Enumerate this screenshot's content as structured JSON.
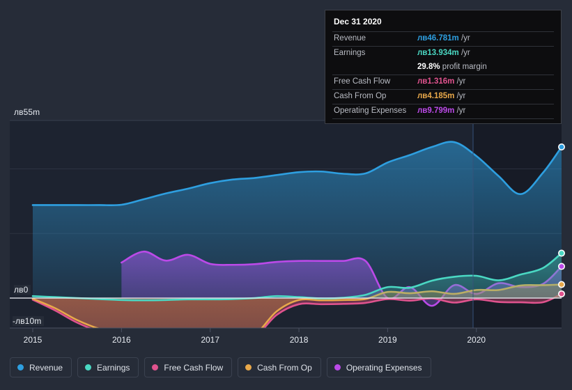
{
  "currency_symbol": "лв",
  "colors": {
    "background": "#262c38",
    "plot_background": "#1d2330",
    "plot_background_forecast": "#171b26",
    "gridline": "#3a4150",
    "zero_line": "#e8ecf2",
    "revenue": "#2e9fe0",
    "earnings": "#4ad8c3",
    "free_cash_flow": "#e0538e",
    "cash_from_op": "#e8a84a",
    "operating_expenses": "#bb4ae8"
  },
  "tooltip": {
    "title": "Dec 31 2020",
    "rows": [
      {
        "key": "Revenue",
        "symbol": "лв",
        "value": "46.781m",
        "unit": "/yr",
        "color": "#2e9fe0"
      },
      {
        "key": "Earnings",
        "symbol": "лв",
        "value": "13.934m",
        "unit": "/yr",
        "color": "#4ad8c3"
      },
      {
        "key": "Free Cash Flow",
        "symbol": "лв",
        "value": "1.316m",
        "unit": "/yr",
        "color": "#e0538e"
      },
      {
        "key": "Cash From Op",
        "symbol": "лв",
        "value": "4.185m",
        "unit": "/yr",
        "color": "#e8a84a"
      },
      {
        "key": "Operating Expenses",
        "symbol": "лв",
        "value": "9.799m",
        "unit": "/yr",
        "color": "#bb4ae8"
      }
    ],
    "profit_margin_value": "29.8%",
    "profit_margin_label": "profit margin"
  },
  "legend": {
    "items": [
      {
        "label": "Revenue",
        "color": "#2e9fe0"
      },
      {
        "label": "Earnings",
        "color": "#4ad8c3"
      },
      {
        "label": "Free Cash Flow",
        "color": "#e0538e"
      },
      {
        "label": "Cash From Op",
        "color": "#e8a84a"
      },
      {
        "label": "Operating Expenses",
        "color": "#bb4ae8"
      }
    ]
  },
  "axes": {
    "y_labels": {
      "top": "лв55m",
      "zero": "лв0",
      "bottom": "-лв10m"
    },
    "x_labels": [
      "2015",
      "2016",
      "2017",
      "2018",
      "2019",
      "2020"
    ]
  },
  "chart_data": {
    "type": "area",
    "title": "",
    "xlabel": "",
    "ylabel": "",
    "ylim": [
      -10,
      55
    ],
    "ytick_values": [
      55,
      0,
      -10
    ],
    "ytick_labels": [
      "лв55m",
      "лв0",
      "-лв10m"
    ],
    "gridlines": [
      55,
      40,
      20
    ],
    "grid": true,
    "zero_line": 0,
    "legend_position": "bottom",
    "x": [
      "2015.00",
      "2015.25",
      "2015.50",
      "2015.75",
      "2016.00",
      "2016.25",
      "2016.50",
      "2016.75",
      "2017.00",
      "2017.25",
      "2017.50",
      "2017.75",
      "2018.00",
      "2018.25",
      "2018.50",
      "2018.75",
      "2019.00",
      "2019.25",
      "2019.50",
      "2019.75",
      "2020.00",
      "2020.25",
      "2020.50",
      "2020.75",
      "2020.96"
    ],
    "forecast_divider_x": "2020.00",
    "series": [
      {
        "name": "Revenue",
        "color": "#2e9fe0",
        "values": [
          28.8,
          28.8,
          28.8,
          28.8,
          28.9,
          30.6,
          32.4,
          33.9,
          35.6,
          36.7,
          37.2,
          38.1,
          39.0,
          39.2,
          38.5,
          38.6,
          42.0,
          44.3,
          46.8,
          48.3,
          44.0,
          37.8,
          32.2,
          38.8,
          46.8
        ]
      },
      {
        "name": "Earnings",
        "color": "#4ad8c3",
        "values": [
          0.6,
          0.3,
          0.0,
          -0.3,
          -0.6,
          -0.7,
          -0.6,
          -0.4,
          -0.4,
          -0.3,
          0.0,
          0.6,
          0.3,
          -0.1,
          0.1,
          1.0,
          3.4,
          3.2,
          5.4,
          6.6,
          6.9,
          5.5,
          7.3,
          9.3,
          13.9
        ]
      },
      {
        "name": "Free Cash Flow",
        "color": "#e0538e",
        "values": [
          -0.5,
          -3.8,
          -7.6,
          -10.3,
          -11.6,
          -11.8,
          -11.6,
          -11.8,
          -11.8,
          -11.7,
          -11.9,
          -5.2,
          -1.9,
          -1.9,
          -1.8,
          -1.5,
          -0.3,
          -0.8,
          -0.1,
          -1.4,
          -0.4,
          -1.2,
          -1.3,
          -1.3,
          1.3
        ]
      },
      {
        "name": "Cash From Op",
        "color": "#e8a84a",
        "values": [
          -0.2,
          -3.1,
          -6.8,
          -9.5,
          -10.8,
          -11.1,
          -10.9,
          -11.1,
          -11.1,
          -11.0,
          -11.2,
          -4.1,
          -0.6,
          -0.7,
          -0.6,
          -0.3,
          1.9,
          1.5,
          2.1,
          1.3,
          2.5,
          2.5,
          3.9,
          4.0,
          4.2
        ]
      },
      {
        "name": "Operating Expenses",
        "color": "#bb4ae8",
        "values": [
          null,
          null,
          null,
          null,
          11.0,
          14.4,
          11.6,
          13.4,
          10.6,
          10.3,
          10.5,
          11.2,
          11.5,
          11.5,
          11.5,
          11.5,
          0.0,
          3.4,
          -2.4,
          4.0,
          1.3,
          4.6,
          3.4,
          4.4,
          9.8
        ]
      }
    ]
  }
}
